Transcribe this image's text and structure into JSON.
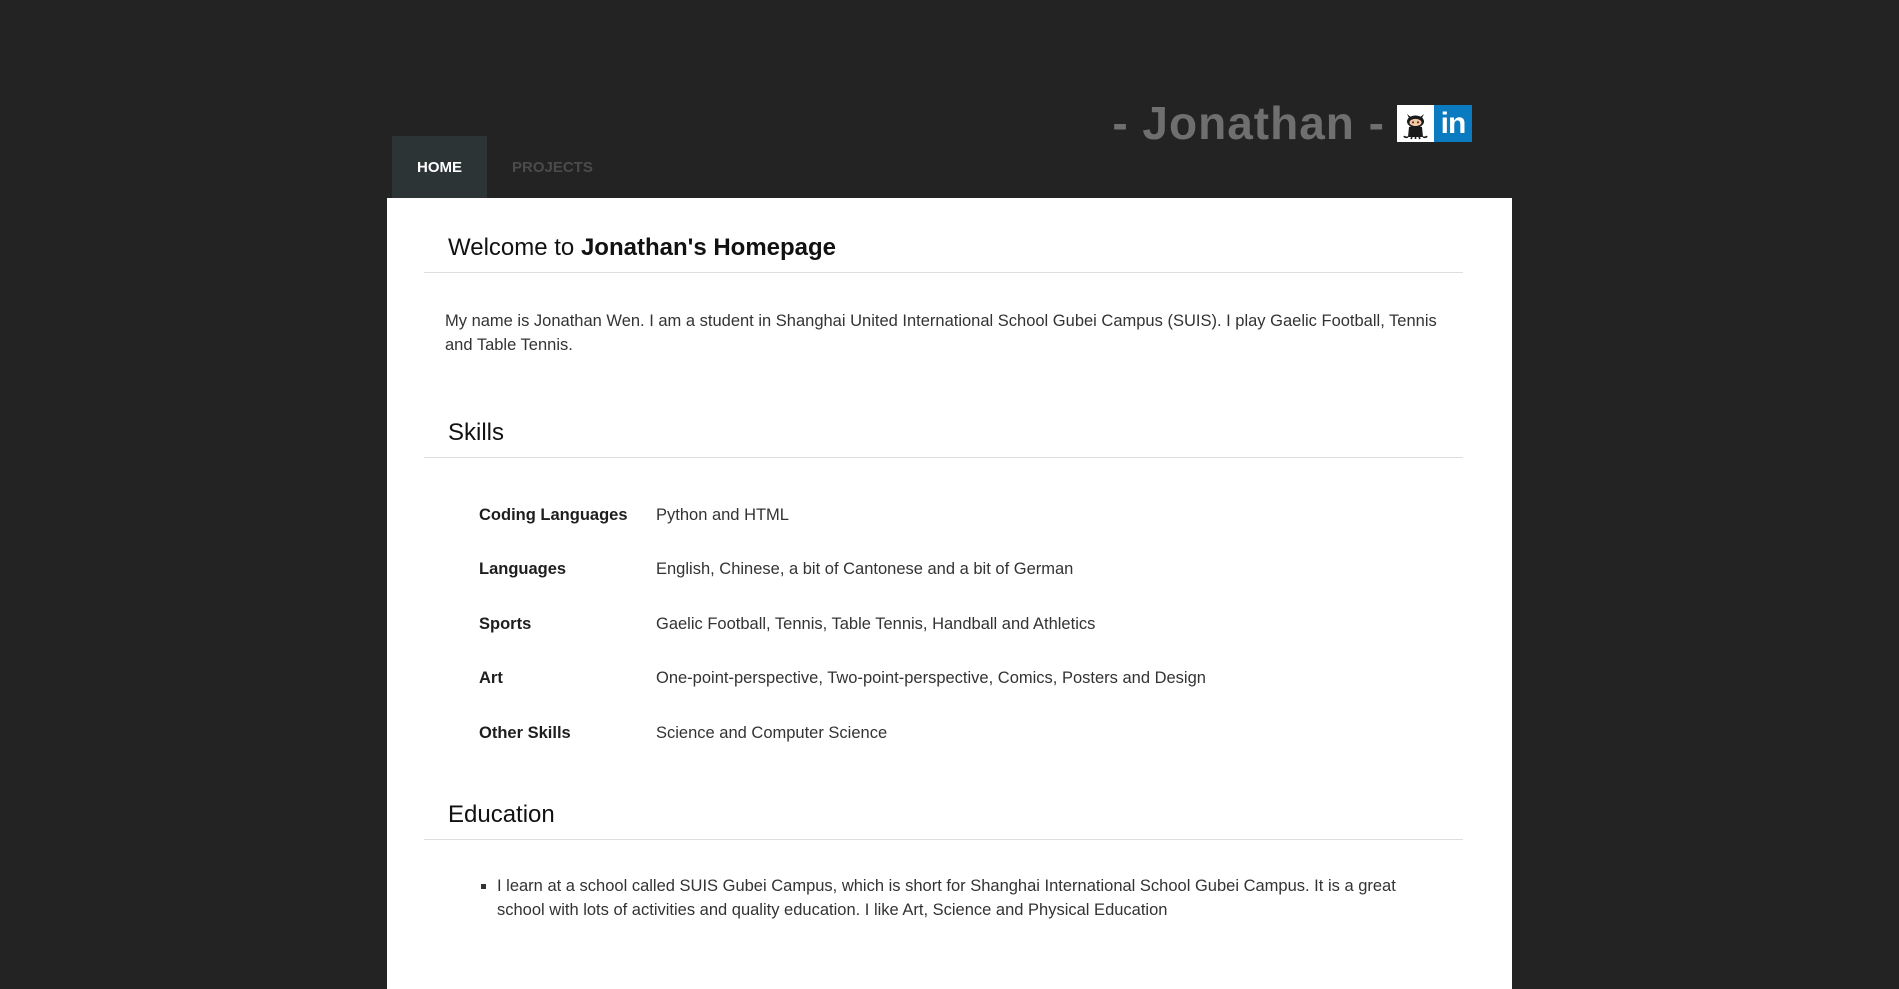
{
  "header": {
    "brand_name": "- Jonathan -",
    "github_icon": "github-octocat-icon",
    "linkedin_text": "in",
    "linkedin_color": "#0a7bc0"
  },
  "nav": {
    "items": [
      {
        "label": "HOME",
        "active": true
      },
      {
        "label": "PROJECTS",
        "active": false
      }
    ]
  },
  "welcome": {
    "title_prefix": "Welcome to ",
    "title_bold": "Jonathan's Homepage",
    "intro": "My name is Jonathan Wen. I am a student in Shanghai United International School Gubei Campus (SUIS). I play Gaelic Football, Tennis and Table Tennis."
  },
  "skills": {
    "title": "Skills",
    "rows": [
      {
        "label": "Coding Languages",
        "value": "Python and HTML"
      },
      {
        "label": "Languages",
        "value": "English, Chinese, a bit of Cantonese and a bit of German"
      },
      {
        "label": "Sports",
        "value": "Gaelic Football, Tennis, Table Tennis, Handball and Athletics"
      },
      {
        "label": "Art",
        "value": "One-point-perspective, Two-point-perspective, Comics, Posters and Design"
      },
      {
        "label": "Other Skills",
        "value": "Science and Computer Science"
      }
    ]
  },
  "education": {
    "title": "Education",
    "items": [
      "I learn at a school called SUIS Gubei Campus, which is short for Shanghai International School Gubei Campus. It is a great school with lots of activities and quality education. I like Art, Science and Physical Education"
    ]
  },
  "colors": {
    "page_background": "#232323",
    "active_nav_background": "#2c3436",
    "panel_background": "#ffffff"
  }
}
